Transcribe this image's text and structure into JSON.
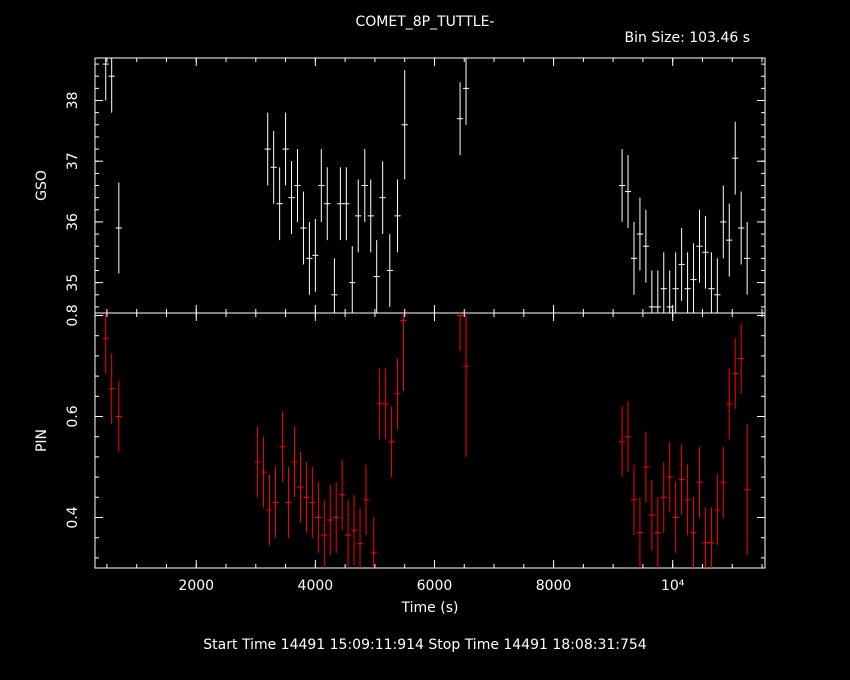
{
  "header": {
    "title": "COMET_8P_TUTTLE-",
    "bin_size": "Bin Size: 103.46 s"
  },
  "footer": {
    "times": "Start Time 14491 15:09:11:914     Stop Time 14491 18:08:31:754"
  },
  "chart_data": {
    "type": "scatter",
    "xlabel": "Time (s)",
    "xlim": [
      300,
      11550
    ],
    "x_ticks": [
      {
        "value": 2000,
        "label": "2000"
      },
      {
        "value": 4000,
        "label": "4000"
      },
      {
        "value": 6000,
        "label": "6000"
      },
      {
        "value": 8000,
        "label": "8000"
      },
      {
        "value": 10000,
        "label": "10⁴"
      }
    ],
    "panels": [
      {
        "name": "GSO",
        "ylabel": "GSO",
        "ylim": [
          34.5,
          38.7
        ],
        "y_ticks": [
          {
            "value": 35,
            "label": "35"
          },
          {
            "value": 36,
            "label": "36"
          },
          {
            "value": 37,
            "label": "37"
          },
          {
            "value": 38,
            "label": "38"
          }
        ],
        "color": "#ffffff",
        "xerr": 52,
        "points": [
          {
            "x": 480,
            "y": 38.6,
            "err": 0.6
          },
          {
            "x": 580,
            "y": 38.4,
            "err": 0.6
          },
          {
            "x": 700,
            "y": 35.9,
            "err": 0.75
          },
          {
            "x": 3200,
            "y": 37.2,
            "err": 0.6
          },
          {
            "x": 3300,
            "y": 36.9,
            "err": 0.6
          },
          {
            "x": 3400,
            "y": 36.3,
            "err": 0.6
          },
          {
            "x": 3500,
            "y": 37.2,
            "err": 0.6
          },
          {
            "x": 3600,
            "y": 36.4,
            "err": 0.6
          },
          {
            "x": 3700,
            "y": 36.6,
            "err": 0.6
          },
          {
            "x": 3800,
            "y": 35.9,
            "err": 0.6
          },
          {
            "x": 3900,
            "y": 35.4,
            "err": 0.6
          },
          {
            "x": 4000,
            "y": 35.45,
            "err": 0.6
          },
          {
            "x": 4100,
            "y": 36.6,
            "err": 0.6
          },
          {
            "x": 4200,
            "y": 36.3,
            "err": 0.6
          },
          {
            "x": 4320,
            "y": 34.8,
            "err": 0.6
          },
          {
            "x": 4420,
            "y": 36.3,
            "err": 0.6
          },
          {
            "x": 4520,
            "y": 36.3,
            "err": 0.6
          },
          {
            "x": 4620,
            "y": 35.0,
            "err": 0.6
          },
          {
            "x": 4720,
            "y": 36.1,
            "err": 0.6
          },
          {
            "x": 4830,
            "y": 36.6,
            "err": 0.6
          },
          {
            "x": 4930,
            "y": 36.1,
            "err": 0.6
          },
          {
            "x": 5030,
            "y": 35.1,
            "err": 0.6
          },
          {
            "x": 5130,
            "y": 36.4,
            "err": 0.6
          },
          {
            "x": 5250,
            "y": 35.2,
            "err": 0.6
          },
          {
            "x": 5380,
            "y": 36.1,
            "err": 0.6
          },
          {
            "x": 5500,
            "y": 37.6,
            "err": 0.9
          },
          {
            "x": 6430,
            "y": 37.7,
            "err": 0.6
          },
          {
            "x": 6530,
            "y": 38.2,
            "err": 0.6
          },
          {
            "x": 9150,
            "y": 36.6,
            "err": 0.6
          },
          {
            "x": 9250,
            "y": 36.5,
            "err": 0.6
          },
          {
            "x": 9350,
            "y": 35.4,
            "err": 0.6
          },
          {
            "x": 9450,
            "y": 35.8,
            "err": 0.6
          },
          {
            "x": 9550,
            "y": 35.6,
            "err": 0.6
          },
          {
            "x": 9650,
            "y": 34.6,
            "err": 0.6
          },
          {
            "x": 9750,
            "y": 34.6,
            "err": 0.6
          },
          {
            "x": 9850,
            "y": 34.9,
            "err": 0.6
          },
          {
            "x": 9950,
            "y": 34.6,
            "err": 0.6
          },
          {
            "x": 10050,
            "y": 34.9,
            "err": 0.6
          },
          {
            "x": 10150,
            "y": 35.3,
            "err": 0.6
          },
          {
            "x": 10250,
            "y": 34.9,
            "err": 0.6
          },
          {
            "x": 10350,
            "y": 35.05,
            "err": 0.6
          },
          {
            "x": 10450,
            "y": 35.6,
            "err": 0.6
          },
          {
            "x": 10550,
            "y": 35.5,
            "err": 0.6
          },
          {
            "x": 10650,
            "y": 34.9,
            "err": 0.6
          },
          {
            "x": 10750,
            "y": 34.8,
            "err": 0.6
          },
          {
            "x": 10850,
            "y": 36.0,
            "err": 0.6
          },
          {
            "x": 10950,
            "y": 35.7,
            "err": 0.6
          },
          {
            "x": 11050,
            "y": 37.05,
            "err": 0.6
          },
          {
            "x": 11150,
            "y": 35.9,
            "err": 0.6
          },
          {
            "x": 11250,
            "y": 35.4,
            "err": 0.6
          }
        ]
      },
      {
        "name": "PIN",
        "ylabel": "PIN",
        "ylim": [
          0.3,
          0.805
        ],
        "y_ticks": [
          {
            "value": 0.4,
            "label": "0.4"
          },
          {
            "value": 0.6,
            "label": "0.6"
          },
          {
            "value": 0.8,
            "label": "0.8"
          }
        ],
        "color": "#ff0000",
        "xerr": 52,
        "points": [
          {
            "x": 480,
            "y": 0.755,
            "err": 0.07
          },
          {
            "x": 580,
            "y": 0.655,
            "err": 0.07
          },
          {
            "x": 700,
            "y": 0.6,
            "err": 0.07
          },
          {
            "x": 3030,
            "y": 0.51,
            "err": 0.07
          },
          {
            "x": 3130,
            "y": 0.49,
            "err": 0.07
          },
          {
            "x": 3230,
            "y": 0.415,
            "err": 0.07
          },
          {
            "x": 3330,
            "y": 0.43,
            "err": 0.07
          },
          {
            "x": 3450,
            "y": 0.54,
            "err": 0.07
          },
          {
            "x": 3550,
            "y": 0.43,
            "err": 0.07
          },
          {
            "x": 3650,
            "y": 0.51,
            "err": 0.07
          },
          {
            "x": 3750,
            "y": 0.46,
            "err": 0.07
          },
          {
            "x": 3850,
            "y": 0.44,
            "err": 0.07
          },
          {
            "x": 3950,
            "y": 0.43,
            "err": 0.07
          },
          {
            "x": 4050,
            "y": 0.4,
            "err": 0.07
          },
          {
            "x": 4150,
            "y": 0.365,
            "err": 0.07
          },
          {
            "x": 4250,
            "y": 0.395,
            "err": 0.07
          },
          {
            "x": 4350,
            "y": 0.4,
            "err": 0.07
          },
          {
            "x": 4450,
            "y": 0.445,
            "err": 0.07
          },
          {
            "x": 4550,
            "y": 0.365,
            "err": 0.07
          },
          {
            "x": 4650,
            "y": 0.375,
            "err": 0.07
          },
          {
            "x": 4750,
            "y": 0.348,
            "err": 0.07
          },
          {
            "x": 4850,
            "y": 0.435,
            "err": 0.07
          },
          {
            "x": 4980,
            "y": 0.33,
            "err": 0.07
          },
          {
            "x": 5080,
            "y": 0.625,
            "err": 0.07
          },
          {
            "x": 5180,
            "y": 0.625,
            "err": 0.07
          },
          {
            "x": 5280,
            "y": 0.55,
            "err": 0.07
          },
          {
            "x": 5380,
            "y": 0.645,
            "err": 0.07
          },
          {
            "x": 5480,
            "y": 0.79,
            "err": 0.14
          },
          {
            "x": 6430,
            "y": 0.8,
            "err": 0.07
          },
          {
            "x": 6530,
            "y": 0.7,
            "err": 0.18
          },
          {
            "x": 9150,
            "y": 0.55,
            "err": 0.07
          },
          {
            "x": 9250,
            "y": 0.56,
            "err": 0.07
          },
          {
            "x": 9350,
            "y": 0.435,
            "err": 0.07
          },
          {
            "x": 9450,
            "y": 0.37,
            "err": 0.07
          },
          {
            "x": 9550,
            "y": 0.5,
            "err": 0.07
          },
          {
            "x": 9650,
            "y": 0.405,
            "err": 0.07
          },
          {
            "x": 9750,
            "y": 0.37,
            "err": 0.07
          },
          {
            "x": 9850,
            "y": 0.44,
            "err": 0.07
          },
          {
            "x": 9950,
            "y": 0.48,
            "err": 0.07
          },
          {
            "x": 10050,
            "y": 0.4,
            "err": 0.07
          },
          {
            "x": 10150,
            "y": 0.475,
            "err": 0.07
          },
          {
            "x": 10250,
            "y": 0.435,
            "err": 0.07
          },
          {
            "x": 10350,
            "y": 0.37,
            "err": 0.07
          },
          {
            "x": 10450,
            "y": 0.47,
            "err": 0.07
          },
          {
            "x": 10550,
            "y": 0.35,
            "err": 0.07
          },
          {
            "x": 10650,
            "y": 0.35,
            "err": 0.07
          },
          {
            "x": 10750,
            "y": 0.415,
            "err": 0.07
          },
          {
            "x": 10850,
            "y": 0.47,
            "err": 0.07
          },
          {
            "x": 10950,
            "y": 0.625,
            "err": 0.07
          },
          {
            "x": 11050,
            "y": 0.685,
            "err": 0.07
          },
          {
            "x": 11150,
            "y": 0.715,
            "err": 0.07
          },
          {
            "x": 11250,
            "y": 0.455,
            "err": 0.13
          }
        ]
      }
    ]
  }
}
